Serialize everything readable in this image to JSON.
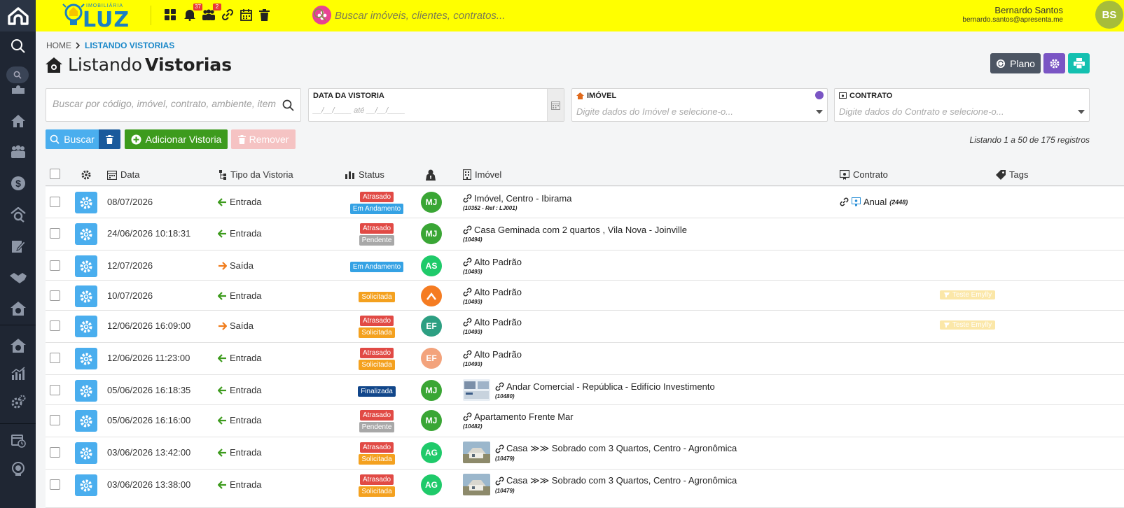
{
  "brand": {
    "sub": "IMOBILIÁRIA",
    "name": "LUZ"
  },
  "topbar": {
    "badges": {
      "notifications": "37",
      "people": "2"
    },
    "search_placeholder": "Buscar imóveis, clientes, contratos..."
  },
  "user": {
    "name": "Bernardo Santos",
    "email": "bernardo.santos@apresenta.me",
    "initials": "BS"
  },
  "breadcrumb": {
    "home": "HOME",
    "current": "LISTANDO VISTORIAS"
  },
  "page": {
    "title_light": "Listando",
    "title_bold": "Vistorias"
  },
  "actions": {
    "plano_label": "Plano"
  },
  "filters": {
    "search_placeholder": "Buscar por código, imóvel, contrato, ambiente, item",
    "date_label": "DATA DA VISTORIA",
    "date_placeholder": "__/__/____  até  __/__/____",
    "imovel_label": "IMÓVEL",
    "imovel_placeholder": "Digite dados do Imóvel e selecione-o...",
    "contrato_label": "CONTRATO",
    "contrato_placeholder": "Digite dados do Contrato e selecione-o..."
  },
  "buttons": {
    "buscar": "Buscar",
    "adicionar": "Adicionar Vistoria",
    "remover": "Remover"
  },
  "listing_info": "Listando 1 a 50 de 175 registros",
  "columns": {
    "data": "Data",
    "tipo": "Tipo da Vistoria",
    "status": "Status",
    "imovel": "Imóvel",
    "contrato": "Contrato",
    "tags": "Tags"
  },
  "colors": {
    "accent": "#4aaeee",
    "topbar": "#ffff00",
    "rail": "#1f2633"
  },
  "rows": [
    {
      "date": "08/07/2026",
      "tipo": "Entrada",
      "statuses": [
        "Atrasado",
        "Em Andamento"
      ],
      "user": "MJ",
      "imovel": "Imóvel, Centro - Ibirama",
      "code": "(10352 - Ref : LJ001)",
      "contrato": "Anual",
      "contrato_code": "(2448)",
      "tag": ""
    },
    {
      "date": "24/06/2026 10:18:31",
      "tipo": "Entrada",
      "statuses": [
        "Atrasado",
        "Pendente"
      ],
      "user": "MJ",
      "imovel": "Casa Geminada com 2 quartos , Vila Nova - Joinville",
      "code": "(10494)",
      "contrato": "",
      "contrato_code": "",
      "tag": ""
    },
    {
      "date": "12/07/2026",
      "tipo": "Saída",
      "statuses": [
        "Em Andamento"
      ],
      "user": "AS",
      "imovel": "Alto Padrão",
      "code": "(10493)",
      "contrato": "",
      "contrato_code": "",
      "tag": ""
    },
    {
      "date": "10/07/2026",
      "tipo": "Entrada",
      "statuses": [
        "Solicitada"
      ],
      "user": "",
      "imovel": "Alto Padrão",
      "code": "(10493)",
      "contrato": "",
      "contrato_code": "",
      "tag": "Teste Emylly"
    },
    {
      "date": "12/06/2026 16:09:00",
      "tipo": "Saída",
      "statuses": [
        "Atrasado",
        "Solicitada"
      ],
      "user": "EF",
      "imovel": "Alto Padrão",
      "code": "(10493)",
      "contrato": "",
      "contrato_code": "",
      "tag": "Teste Emylly"
    },
    {
      "date": "12/06/2026 11:23:00",
      "tipo": "Entrada",
      "statuses": [
        "Atrasado",
        "Solicitada"
      ],
      "user": "EF",
      "imovel": "Alto Padrão",
      "code": "(10493)",
      "contrato": "",
      "contrato_code": "",
      "tag": ""
    },
    {
      "date": "05/06/2026 16:18:35",
      "tipo": "Entrada",
      "statuses": [
        "Finalizada"
      ],
      "user": "MJ",
      "imovel": "Andar Comercial - República - Edifício Investimento",
      "code": "(10480)",
      "contrato": "",
      "contrato_code": "",
      "tag": ""
    },
    {
      "date": "05/06/2026 16:16:00",
      "tipo": "Entrada",
      "statuses": [
        "Atrasado",
        "Pendente"
      ],
      "user": "MJ",
      "imovel": "Apartamento Frente Mar",
      "code": "(10482)",
      "contrato": "",
      "contrato_code": "",
      "tag": ""
    },
    {
      "date": "03/06/2026 13:42:00",
      "tipo": "Entrada",
      "statuses": [
        "Atrasado",
        "Solicitada"
      ],
      "user": "AG",
      "imovel": "Casa ≫≫ Sobrado com 3 Quartos, Centro - Agronômica",
      "code": "(10479)",
      "contrato": "",
      "contrato_code": "",
      "tag": ""
    },
    {
      "date": "03/06/2026 13:38:00",
      "tipo": "Entrada",
      "statuses": [
        "Atrasado",
        "Solicitada"
      ],
      "user": "AG",
      "imovel": "Casa ≫≫ Sobrado com 3 Quartos, Centro - Agronômica",
      "code": "(10479)",
      "contrato": "",
      "contrato_code": "",
      "tag": ""
    }
  ]
}
